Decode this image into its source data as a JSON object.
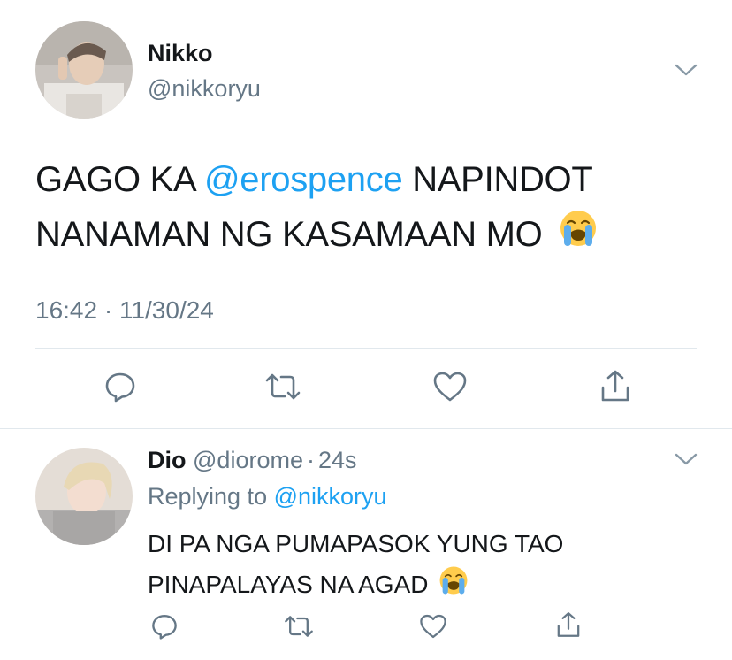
{
  "main_tweet": {
    "display_name": "Nikko",
    "handle": "@nikkoryu",
    "text_before_mention": "GAGO KA ",
    "mention": "@erospence",
    "text_after_mention": " NAPINDOT",
    "line2": "NANAMAN NG KASAMAAN MO",
    "timestamp": "16:42 · 11/30/24"
  },
  "reply": {
    "display_name": "Dio",
    "handle": "@diorome",
    "separator": "·",
    "age": "24s",
    "replying_prefix": "Replying to ",
    "replying_handle": "@nikkoryu",
    "line1": "DI PA NGA PUMAPASOK YUNG TAO",
    "line2": "PINAPALAYAS NA AGAD"
  },
  "icons": {
    "reply": "reply-icon",
    "retweet": "retweet-icon",
    "like": "like-icon",
    "share": "share-icon",
    "menu": "chevron-down-icon",
    "emoji": "loudly-crying-face-emoji"
  },
  "colors": {
    "accent": "#1da1f2",
    "secondary_text": "#657786",
    "divider": "#e1e8ed"
  }
}
